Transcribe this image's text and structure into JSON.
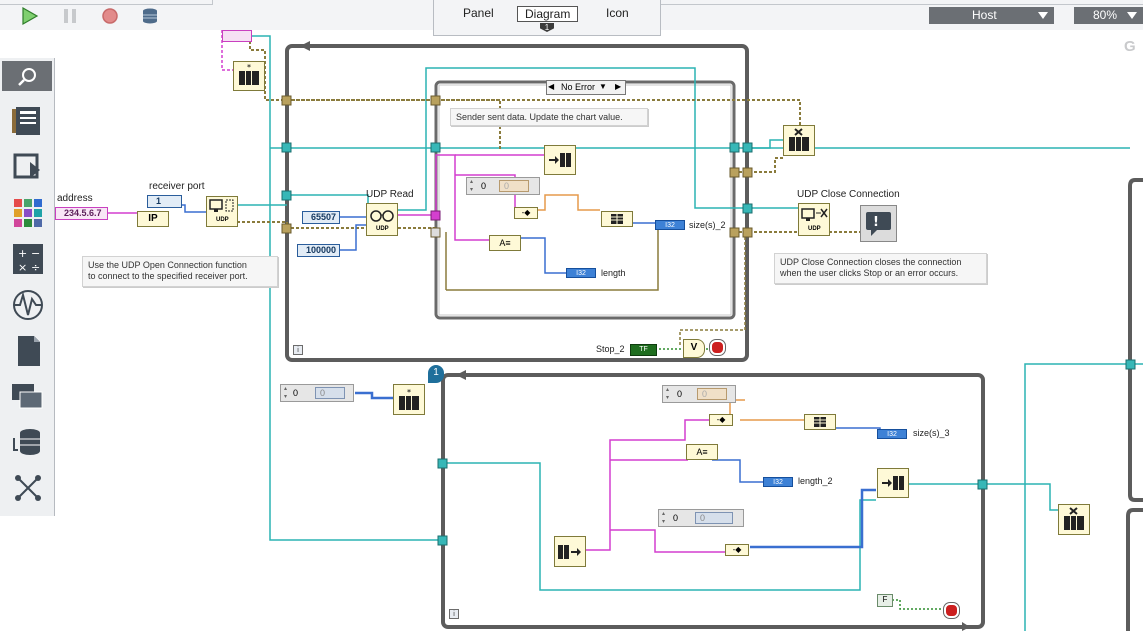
{
  "toolbar": {
    "run_icon": "run-arrow-icon",
    "pause_icon": "pause-icon",
    "abort_icon": "abort-icon",
    "highlight_icon": "database-stack-icon"
  },
  "tabs": [
    "Panel",
    "Diagram",
    "Icon"
  ],
  "active_tab": "Diagram",
  "tab_badge": "1",
  "target_select": {
    "value": "Host"
  },
  "zoom_select": {
    "value": "80%"
  },
  "corner_letter": "G",
  "palette": {
    "icons": [
      "search-icon",
      "document-icon",
      "loop-icon",
      "grid-icon",
      "math-icon",
      "signal-icon",
      "file-icon",
      "devices-icon",
      "database-icon",
      "network-icon"
    ]
  },
  "diagram": {
    "address_label": "address",
    "address_value": "234.5.6.7",
    "receiver_port_label": "receiver port",
    "receiver_port_value": "1",
    "udp_read_label": "UDP Read",
    "const_65507": "65507",
    "const_100000": "100000",
    "case_selector": "No Error",
    "comment_sender": "Sender sent data. Update the chart value.",
    "comment_open": [
      "Use the UDP Open Connection function",
      "to connect to the specified receiver port."
    ],
    "comment_close": [
      "UDP Close Connection closes the connection",
      "when the user clicks Stop or an error occurs."
    ],
    "udp_close_label": "UDP Close Connection",
    "const_zero_a": "0",
    "const_zero_b": "0",
    "const_zero_c": "0",
    "const_zero_d": "0",
    "const_zero_e": "0",
    "const_zero_f": "0",
    "const_zero_g": "0",
    "size_label": "size(s)_2",
    "length_label": "length",
    "size3_label": "size(s)_3",
    "length2_label": "length_2",
    "stop_label": "Stop_2",
    "tf_label": "TF",
    "false_label": "F",
    "i32": "I32",
    "loop_badge": "1",
    "info_i": "i",
    "udp_text": "UDP",
    "ip_text": "IP",
    "v_text": "V"
  }
}
